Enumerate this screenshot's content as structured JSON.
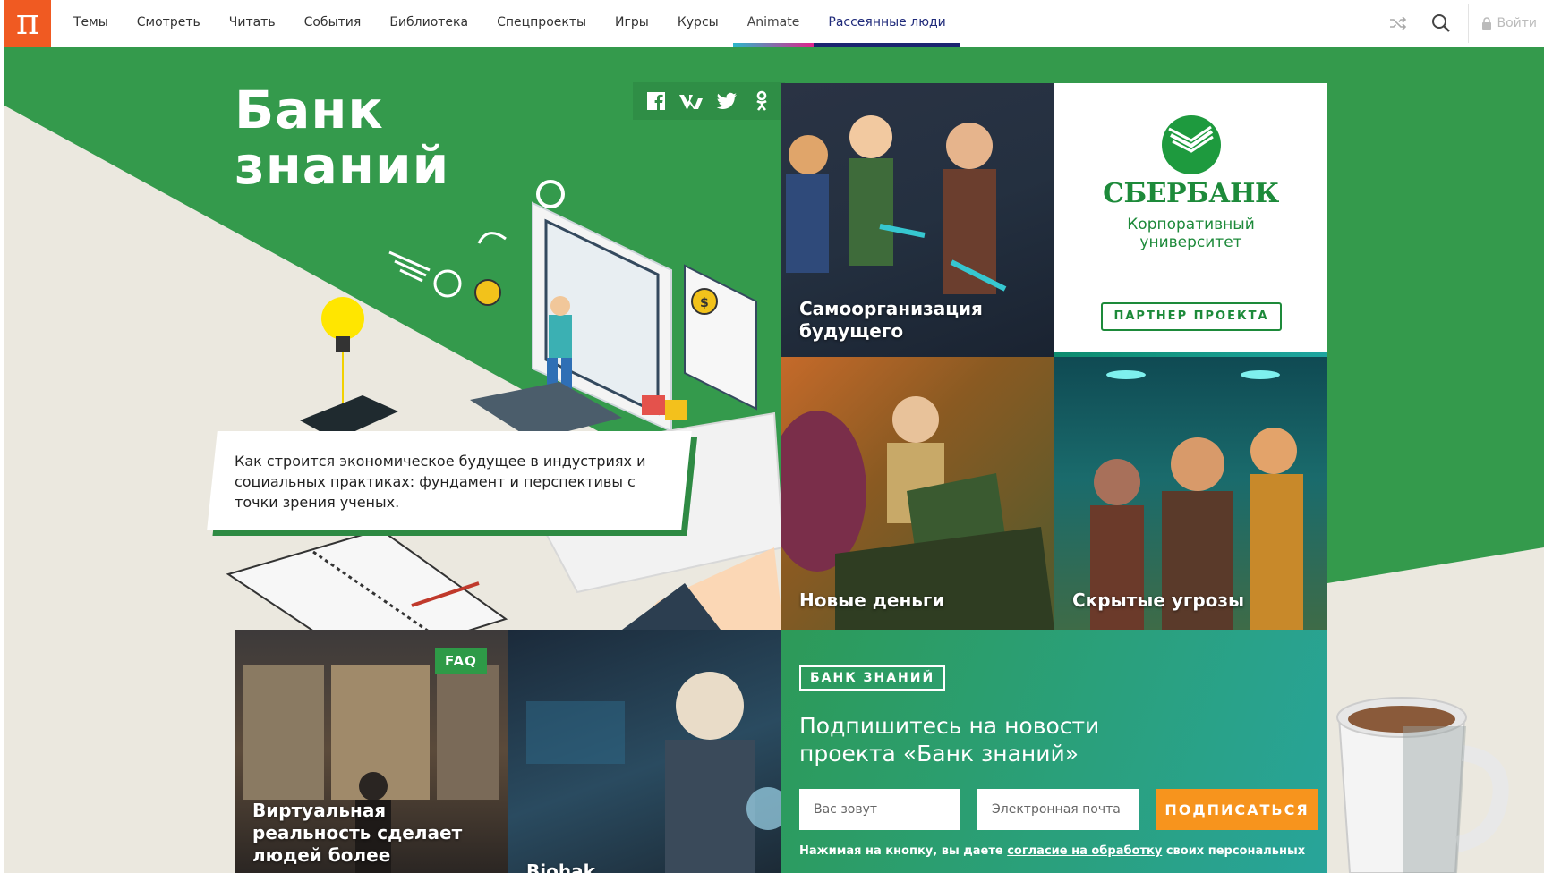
{
  "logo": {
    "glyph": "π"
  },
  "menu": [
    {
      "label": "Темы"
    },
    {
      "label": "Смотреть"
    },
    {
      "label": "Читать"
    },
    {
      "label": "События"
    },
    {
      "label": "Библиотека"
    },
    {
      "label": "Спецпроекты"
    },
    {
      "label": "Игры"
    },
    {
      "label": "Курсы"
    },
    {
      "label": "Animate"
    },
    {
      "label": "Рассеянные люди"
    }
  ],
  "nav_right": {
    "login_label": "Войти"
  },
  "hero": {
    "title_line1": "Банк",
    "title_line2": "знаний",
    "description": "Как строится экономическое будущее в индустриях и социальных практиках: фундамент и перспективы с точки зрения ученых.",
    "share": [
      "facebook-icon",
      "vk-icon",
      "twitter-icon",
      "odnoklassniki-icon"
    ]
  },
  "tiles": {
    "self_org": "Самоорганизация будущего",
    "new_money": "Новые деньги",
    "hidden_threats": "Скрытые угрозы",
    "vr": "Виртуальная реальность сделает людей более",
    "vr_badge": "FAQ",
    "bio": "Biohak"
  },
  "partner": {
    "name": "СБЕРБАНК",
    "sub_line1": "Корпоративный",
    "sub_line2": "университет",
    "badge": "ПАРТНЕР ПРОЕКТА"
  },
  "subscribe": {
    "badge": "БАНК ЗНАНИЙ",
    "title_line1": "Подпишитесь на новости",
    "title_line2": "проекта «Банк знаний»",
    "name_placeholder": "Вас зовут",
    "email_placeholder": "Электронная почта",
    "button": "ПОДПИСАТЬСЯ",
    "note_prefix": "Нажимая на кнопку, вы даете ",
    "note_link": "согласие на обработку",
    "note_suffix": " своих персональных"
  },
  "colors": {
    "brand_orange": "#f05a22",
    "stage_green": "#349a4c",
    "sber_green": "#1d8a3a",
    "subscribe_button": "#f7941d"
  }
}
